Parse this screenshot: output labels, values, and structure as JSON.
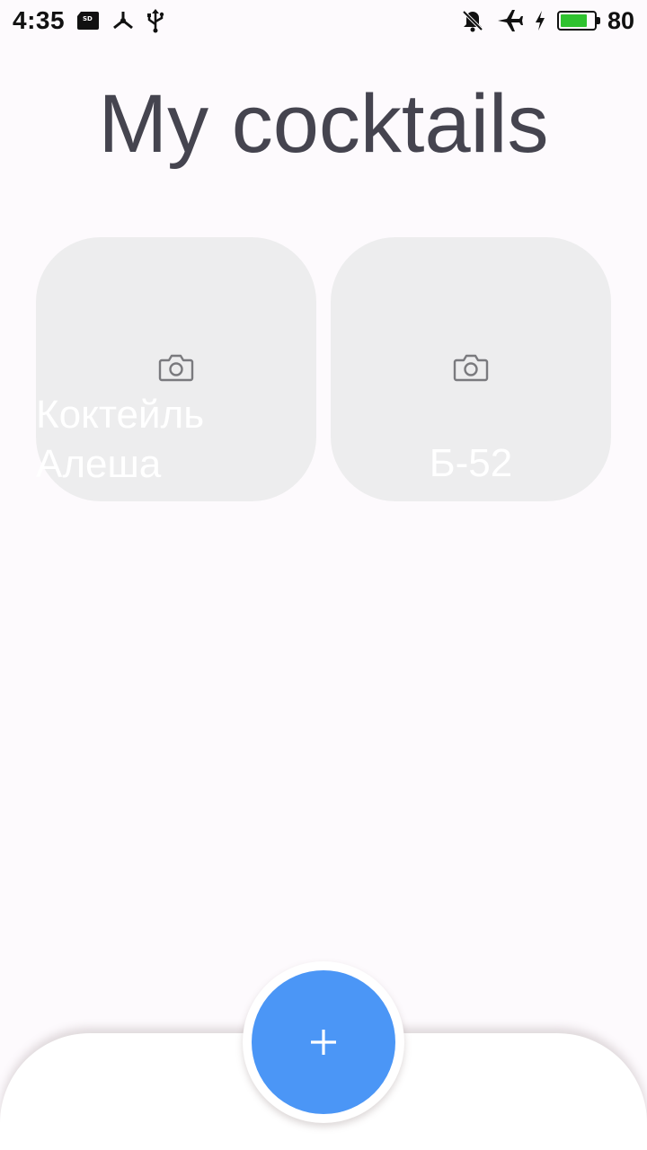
{
  "status_bar": {
    "time": "4:35",
    "battery_percent": "80",
    "battery_level": 0.8,
    "icons_left": [
      "sd-card-icon",
      "network-share-icon",
      "usb-icon"
    ],
    "icons_right": [
      "notifications-muted-icon",
      "airplane-mode-icon",
      "charging-icon",
      "battery-icon"
    ]
  },
  "header": {
    "title": "My cocktails"
  },
  "cocktails": [
    {
      "name": "Коктейль\nАлеша",
      "image_placeholder": "camera-icon"
    },
    {
      "name": "Б-52",
      "image_placeholder": "camera-icon"
    }
  ],
  "fab": {
    "icon": "plus-icon",
    "color": "#4b96f6"
  },
  "colors": {
    "background": "#fdfafd",
    "card": "#ededee",
    "title": "#45444f",
    "accent": "#4b96f6",
    "battery": "#2fc22f"
  }
}
